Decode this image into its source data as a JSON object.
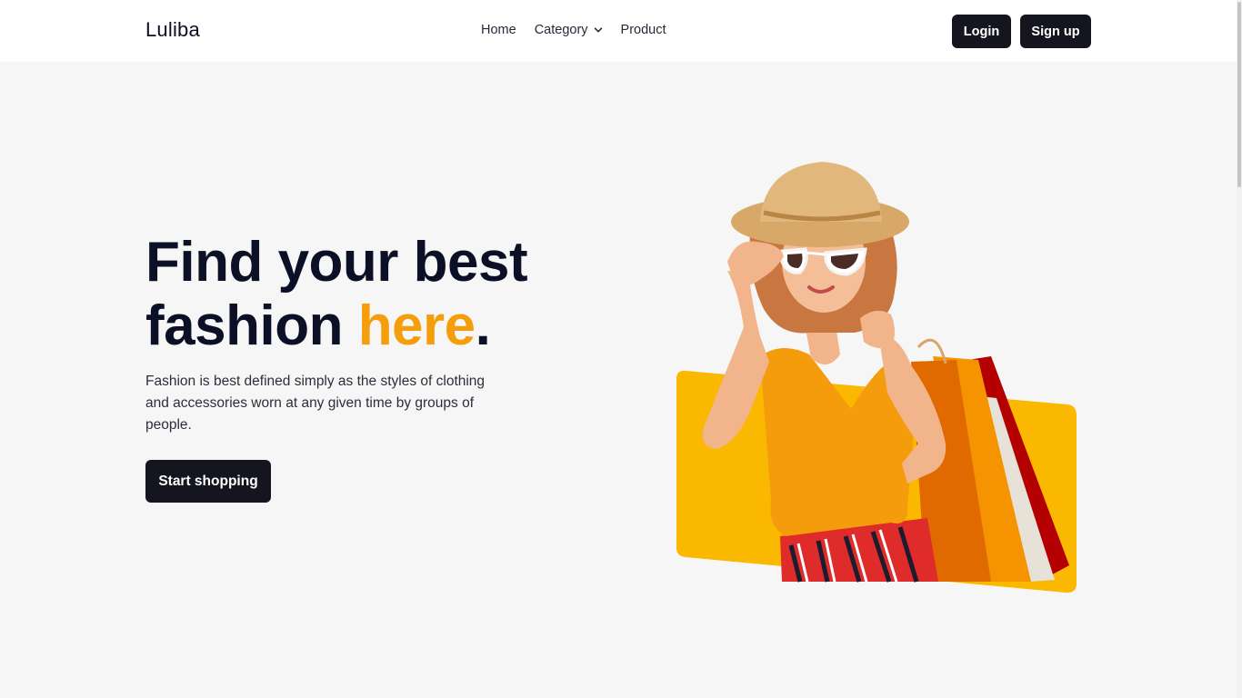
{
  "nav": {
    "logo": "Luliba",
    "links": [
      {
        "label": "Home"
      },
      {
        "label": "Category",
        "has_dropdown": true
      },
      {
        "label": "Product"
      }
    ],
    "login_label": "Login",
    "signup_label": "Sign up"
  },
  "hero": {
    "title_line1": "Find your best",
    "title_line2_start": "fashion ",
    "title_accent": "here",
    "title_end": ".",
    "description": "Fashion is best defined simply as the styles of clothing and accessories worn at any given time by groups of people.",
    "cta_label": "Start shopping",
    "image": "woman-with-shopping-bags-illustration"
  },
  "colors": {
    "accent": "#f59e0b",
    "dark": "#14151f",
    "yellow_card": "#fbb800",
    "background": "#f6f6f6"
  }
}
